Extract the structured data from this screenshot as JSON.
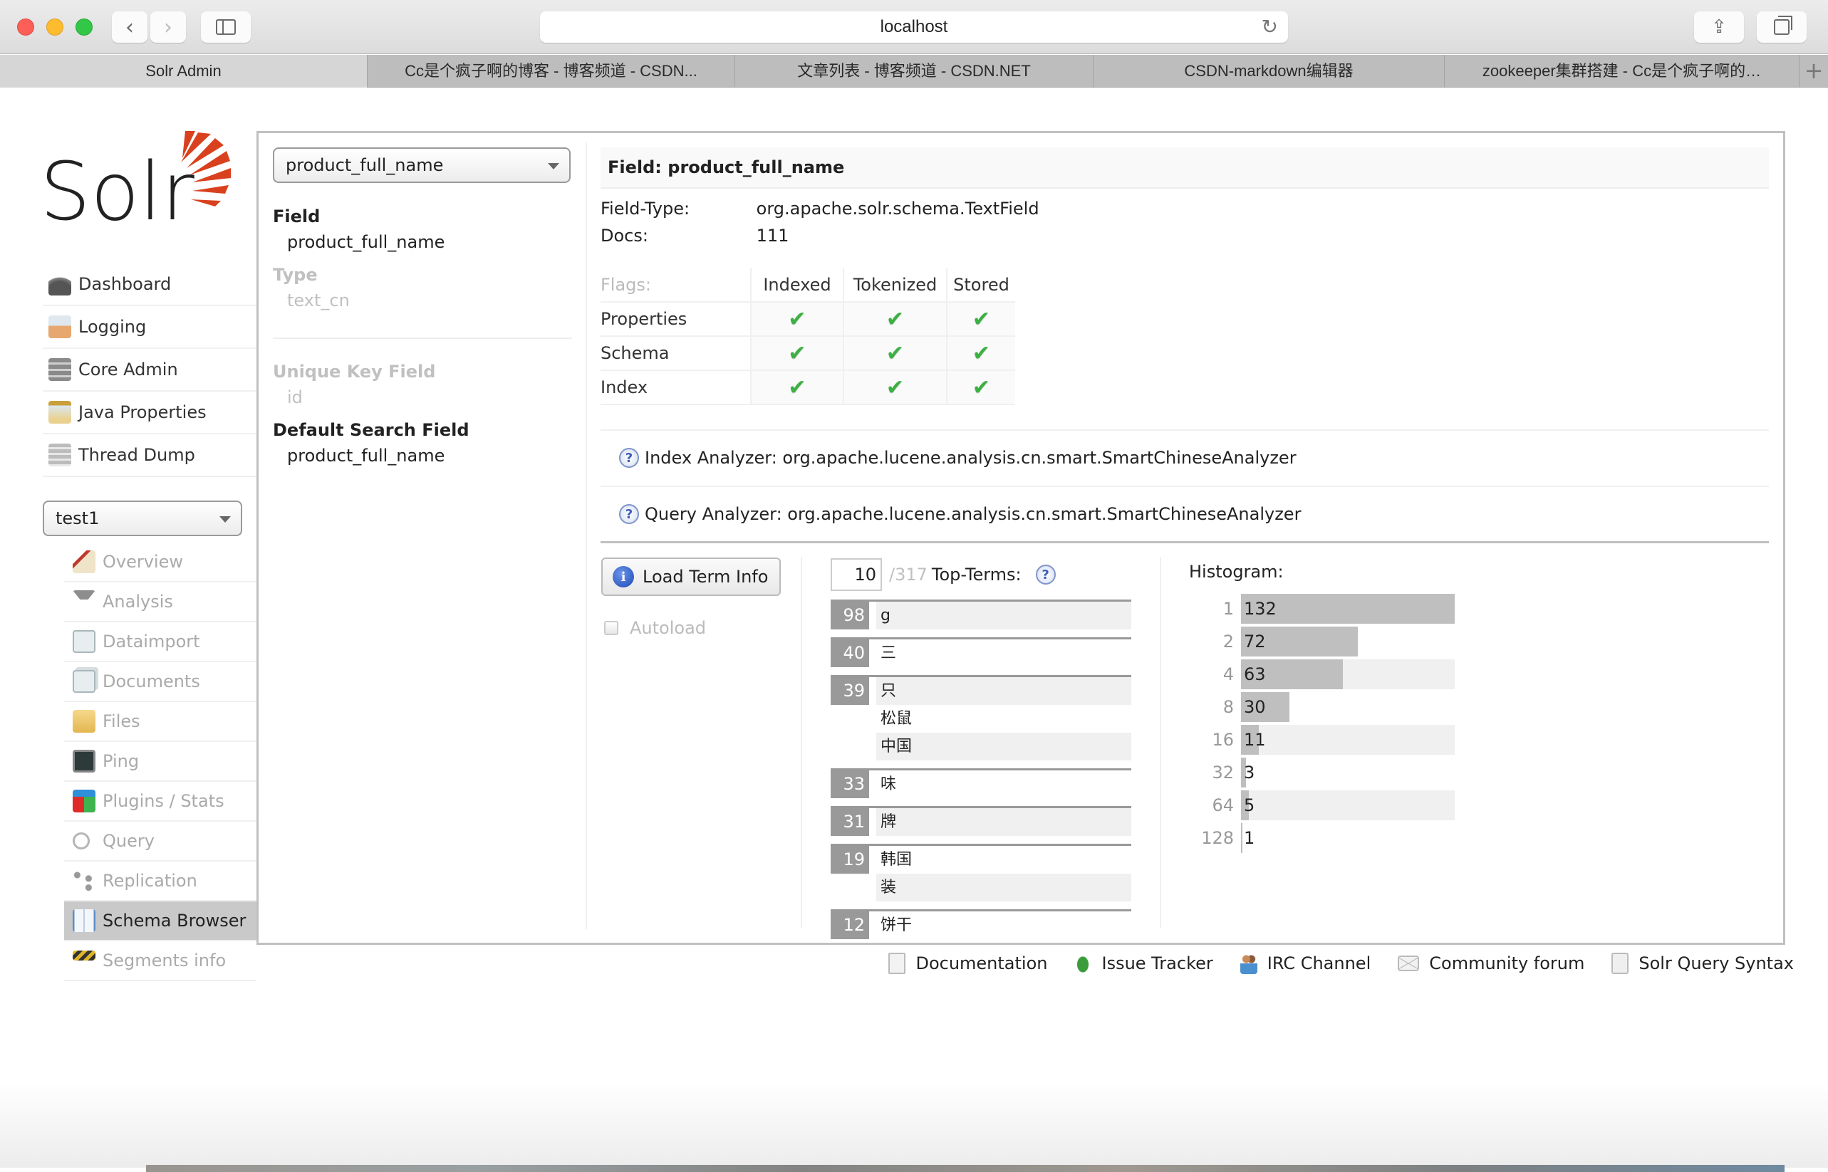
{
  "browser": {
    "url": "localhost",
    "tabs": [
      {
        "label": "Solr Admin",
        "active": true
      },
      {
        "label": "Cc是个疯子啊的博客 - 博客频道 - CSDN...",
        "active": false
      },
      {
        "label": "文章列表 - 博客频道 - CSDN.NET",
        "active": false
      },
      {
        "label": "CSDN-markdown编辑器",
        "active": false
      },
      {
        "label": "zookeeper集群搭建 - Cc是个疯子啊的…",
        "active": false
      }
    ],
    "new_tab_label": "+"
  },
  "logo": {
    "text": "Solr",
    "accent": "#d9411e"
  },
  "main_nav": [
    {
      "label": "Dashboard",
      "icon": "dashboard-icon"
    },
    {
      "label": "Logging",
      "icon": "logging-icon"
    },
    {
      "label": "Core Admin",
      "icon": "core-admin-icon"
    },
    {
      "label": "Java Properties",
      "icon": "java-properties-icon"
    },
    {
      "label": "Thread Dump",
      "icon": "thread-dump-icon"
    }
  ],
  "core_selector": {
    "value": "test1"
  },
  "core_nav": [
    {
      "label": "Overview",
      "icon": "house-icon",
      "active": false
    },
    {
      "label": "Analysis",
      "icon": "funnel-icon",
      "active": false
    },
    {
      "label": "Dataimport",
      "icon": "dataimport-icon",
      "active": false
    },
    {
      "label": "Documents",
      "icon": "documents-icon",
      "active": false
    },
    {
      "label": "Files",
      "icon": "folder-icon",
      "active": false
    },
    {
      "label": "Ping",
      "icon": "ping-monitor-icon",
      "active": false
    },
    {
      "label": "Plugins / Stats",
      "icon": "plugins-blocks-icon",
      "active": false
    },
    {
      "label": "Query",
      "icon": "magnifier-icon",
      "active": false
    },
    {
      "label": "Replication",
      "icon": "replication-icon",
      "active": false
    },
    {
      "label": "Schema Browser",
      "icon": "book-icon",
      "active": true
    },
    {
      "label": "Segments info",
      "icon": "barrier-icon",
      "active": false
    }
  ],
  "schema": {
    "field_select": "product_full_name",
    "field_label": "Field",
    "field_value": "product_full_name",
    "type_label": "Type",
    "type_value": "text_cn",
    "unique_key_label": "Unique Key Field",
    "unique_key_value": "id",
    "default_search_label": "Default Search Field",
    "default_search_value": "product_full_name"
  },
  "field_info": {
    "header": "Field: product_full_name",
    "field_type_label": "Field-Type:",
    "field_type_value": "org.apache.solr.schema.TextField",
    "docs_label": "Docs:",
    "docs_value": "111",
    "flags": {
      "label": "Flags:",
      "columns": [
        "Indexed",
        "Tokenized",
        "Stored"
      ],
      "rows": [
        {
          "label": "Properties",
          "values": [
            true,
            true,
            true
          ]
        },
        {
          "label": "Schema",
          "values": [
            true,
            true,
            true
          ]
        },
        {
          "label": "Index",
          "values": [
            true,
            true,
            true
          ]
        }
      ],
      "check_glyph": "✔"
    },
    "index_analyzer": "Index Analyzer: org.apache.lucene.analysis.cn.smart.SmartChineseAnalyzer",
    "query_analyzer": "Query Analyzer: org.apache.lucene.analysis.cn.smart.SmartChineseAnalyzer"
  },
  "term_info": {
    "load_button": "Load Term Info",
    "autoload_label": "Autoload",
    "autoload_checked": false,
    "top_terms_count": "10",
    "top_terms_total": "/317",
    "top_terms_label": "Top-Terms:",
    "terms": [
      {
        "count": "98",
        "terms": [
          "g"
        ]
      },
      {
        "count": "40",
        "terms": [
          "三"
        ]
      },
      {
        "count": "39",
        "terms": [
          "只",
          "松鼠",
          "中国"
        ]
      },
      {
        "count": "33",
        "terms": [
          "味"
        ]
      },
      {
        "count": "31",
        "terms": [
          "牌"
        ]
      },
      {
        "count": "19",
        "terms": [
          "韩国",
          "装"
        ]
      },
      {
        "count": "12",
        "terms": [
          "饼干"
        ]
      }
    ],
    "histogram_label": "Histogram:",
    "histogram": [
      {
        "key": "1",
        "value": 132
      },
      {
        "key": "2",
        "value": 72
      },
      {
        "key": "4",
        "value": 63
      },
      {
        "key": "8",
        "value": 30
      },
      {
        "key": "16",
        "value": 11
      },
      {
        "key": "32",
        "value": 3
      },
      {
        "key": "64",
        "value": 5
      },
      {
        "key": "128",
        "value": 1
      }
    ]
  },
  "footer": [
    {
      "label": "Documentation",
      "icon": "document-icon"
    },
    {
      "label": "Issue Tracker",
      "icon": "bug-icon"
    },
    {
      "label": "IRC Channel",
      "icon": "people-icon"
    },
    {
      "label": "Community forum",
      "icon": "mail-icon"
    },
    {
      "label": "Solr Query Syntax",
      "icon": "query-syntax-icon"
    }
  ]
}
